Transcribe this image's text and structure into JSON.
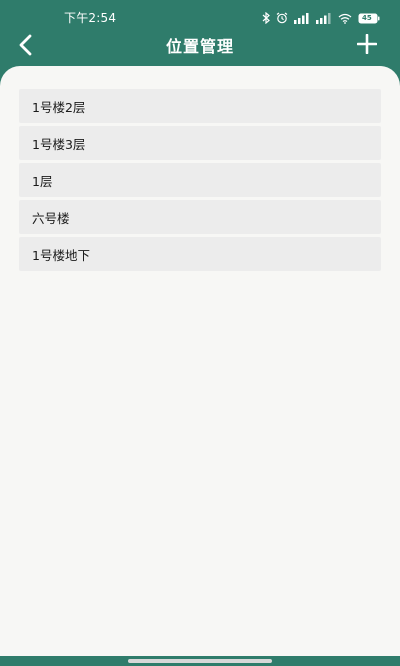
{
  "status_bar": {
    "time": "下午2:54",
    "battery": "45",
    "icons": [
      "bluetooth-icon",
      "alarm-icon",
      "signal-icon",
      "signal-icon",
      "wifi-icon",
      "battery-icon"
    ]
  },
  "header": {
    "title": "位置管理",
    "back_icon": "chevron-left-icon",
    "add_icon": "plus-icon"
  },
  "locations": [
    {
      "name": "1号楼2层"
    },
    {
      "name": "1号楼3层"
    },
    {
      "name": "1层"
    },
    {
      "name": "六号楼"
    },
    {
      "name": "1号楼地下"
    }
  ],
  "colors": {
    "primary": "#2f7c6b",
    "background": "#f7f7f5",
    "item_background": "#ececec",
    "text": "#1a1a1a"
  }
}
